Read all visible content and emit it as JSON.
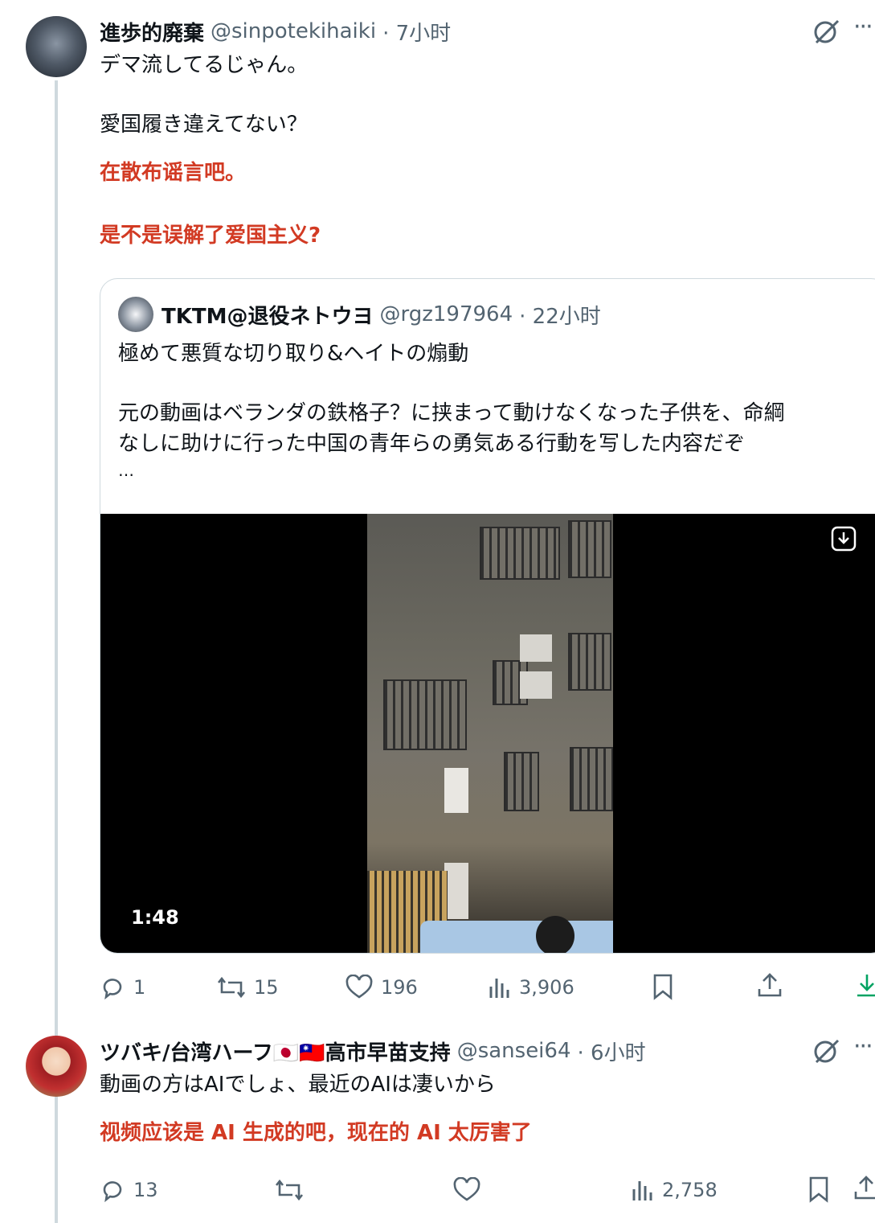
{
  "tweet1": {
    "name": "進歩的廃棄",
    "handle": "@sinpotekihaiki",
    "time": "· 7小时",
    "lines": [
      "デマ流してるじゃん。",
      "愛国履き違えてない？"
    ],
    "translation": [
      "在散布谣言吧。",
      "是不是误解了爱国主义?"
    ],
    "stats": {
      "replies": "1",
      "retweets": "15",
      "likes": "196",
      "views": "3,906"
    }
  },
  "quote": {
    "name": "TKTM@退役ネトウヨ",
    "handle": "@rgz197964",
    "time": "· 22小时",
    "line1": "極めて悪質な切り取り&ヘイトの煽動",
    "line2": "元の動画はベランダの鉄格子？に挟まって動けなくなった子供を、命綱",
    "line3": "なしに助けに行った中国の青年らの勇気ある行動を写した内容だぞ",
    "ellipsis": "…",
    "video_duration": "1:48"
  },
  "tweet2": {
    "name": "ツバキ/台湾ハーフ🇯🇵🇹🇼高市早苗支持",
    "handle": "@sansei64",
    "time": "· 6小时",
    "line": "動画の方はAIでしょ、最近のAIは凄いから",
    "translation": "视频应该是 AI 生成的吧，现在的 AI 太厉害了",
    "stats": {
      "replies": "13",
      "views": "2,758"
    }
  },
  "icons": [
    "grok-icon",
    "more-icon",
    "reply-icon",
    "retweet-icon",
    "like-icon",
    "views-icon",
    "bookmark-icon",
    "share-icon",
    "download-icon"
  ]
}
